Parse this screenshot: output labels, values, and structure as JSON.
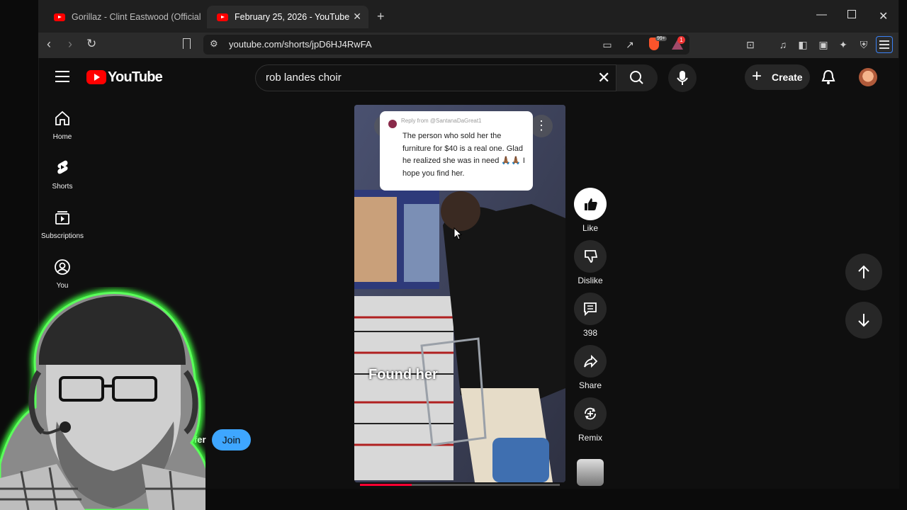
{
  "browser": {
    "tabs": [
      {
        "title": "Gorillaz - Clint Eastwood (Official Vid",
        "active": false
      },
      {
        "title": "February 25, 2026 - YouTube",
        "active": true
      }
    ],
    "new_tab": "+",
    "url": "youtube.com/shorts/jpD6HJ4RwFA",
    "extension_badge": "1",
    "shield_badge": "99+"
  },
  "youtube": {
    "logo": "YouTube",
    "search": {
      "value": "rob landes choir"
    },
    "create_label": "Create",
    "sidebar": [
      {
        "label": "Home",
        "icon": "home-icon"
      },
      {
        "label": "Shorts",
        "icon": "shorts-icon"
      },
      {
        "label": "Subscriptions",
        "icon": "subscriptions-icon"
      },
      {
        "label": "You",
        "icon": "you-icon"
      }
    ],
    "short": {
      "overlay_reply": "Reply from @SantanaDaGreat1",
      "overlay_text": "The person who sold her the furniture for $40 is a real one. Glad he realized she was in need 🙏🏾🙏🏾 I hope you find her.",
      "caption": "Found her",
      "progress_fraction": 0.26,
      "channel_fragment": "oofer",
      "join_label": "Join"
    },
    "actions": {
      "like": "Like",
      "dislike": "Dislike",
      "comments": "398",
      "share": "Share",
      "remix": "Remix"
    }
  },
  "colors": {
    "accent": "#ff0000",
    "join": "#3ea6ff",
    "webcam_glow": "#3cff3c"
  }
}
